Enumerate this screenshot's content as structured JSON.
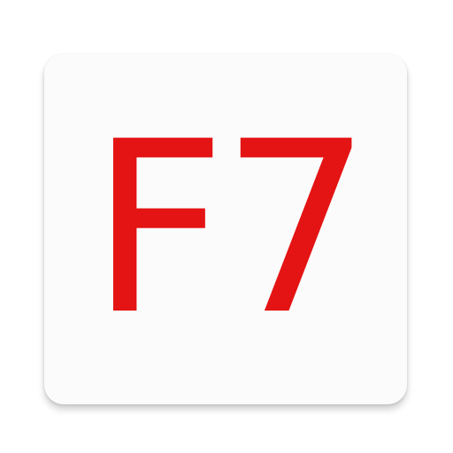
{
  "app_icon": {
    "logo_text": "F7",
    "logo_color": "#e41414",
    "tile_color": "#fbfbfb",
    "background_color": "#ffffff"
  }
}
